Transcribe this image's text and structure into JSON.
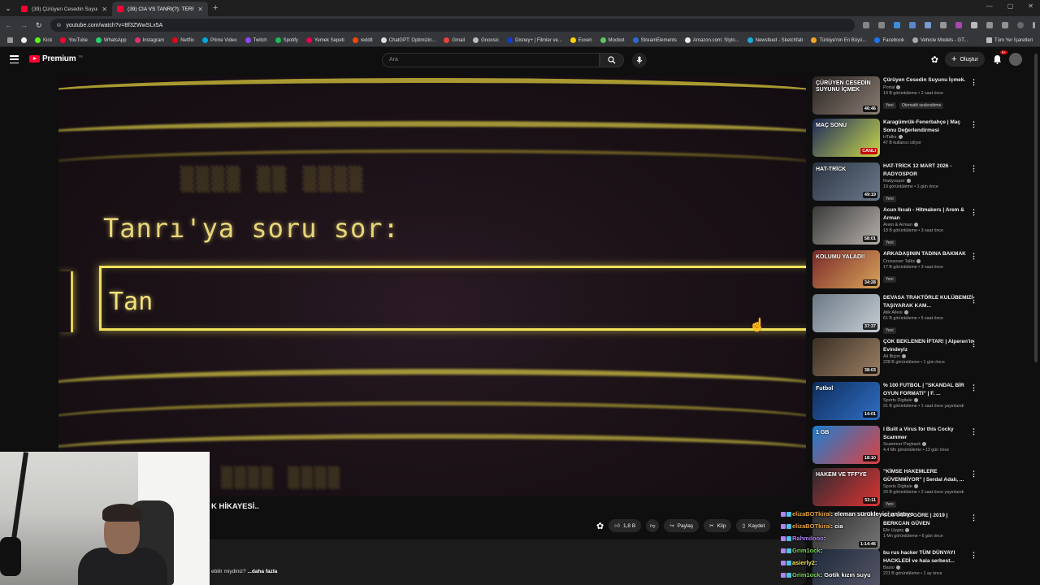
{
  "browser": {
    "tabs": [
      {
        "title": "(39) Çürüyen Cesedin Suyunu İçmek",
        "active": false
      },
      {
        "title": "(39) CIA VS TANRI(?): TERRY DAVIS",
        "active": true
      }
    ],
    "url": "youtube.com/watch?v=Bf3ZWwSLx5A",
    "bookmarks": [
      "Kick",
      "YouTube",
      "WhatsApp",
      "Instagram",
      "Netflix",
      "Prime Video",
      "Twitch",
      "Spotify",
      "Yemek Sepeti",
      "reddit",
      "ChatGPT: Optimizin...",
      "Gmail",
      "Gnoosic",
      "Disney+ | Filmler ve...",
      "Exxen",
      "Moobot",
      "StreamElements",
      "Amazon.com: Stylo...",
      "Newsfeed - Sketchfab",
      "Türkiye'nin En Büyü...",
      "Facebook",
      "Vehicle Models - GT..."
    ],
    "bookmarks_all": "Tüm Yer İşaretleri"
  },
  "youtube": {
    "logo": "Premium",
    "logo_region": "TR",
    "search_placeholder": "Ara",
    "create_label": "Oluştur",
    "notif_count": "9+"
  },
  "video": {
    "prompt": "Tanrı'ya soru sor:",
    "input_text": "Tan",
    "title": "K HİKAYESİ..",
    "likes": "1,8 B",
    "share": "Paylaş",
    "clip": "Klip",
    "save": "Kaydet",
    "description": "ebilir miydiniz?",
    "more": "...daha fazla"
  },
  "chat": [
    {
      "user": "elizaBOTkiral",
      "msg": ": eleman sürükleyici anlatıyo",
      "color": "#e6a23c"
    },
    {
      "user": "elizaBOTkiral",
      "msg": ": cia",
      "color": "#e6a23c"
    },
    {
      "user": "Rahmilooo",
      "msg": ":",
      "color": "#b084f5"
    },
    {
      "user": "Grim1ock",
      "msg": ":",
      "color": "#7ed957"
    },
    {
      "user": "asierly2",
      "msg": ":",
      "color": "#f2e14c"
    },
    {
      "user": "Grim1ock",
      "msg": ": Gotik kızın suyu",
      "color": "#7ed957"
    }
  ],
  "sidebar": [
    {
      "title": "Çürüyen Cesedin Suyunu İçmek.",
      "channel": "Portal",
      "meta": "14 B görüntüleme • 2 saat önce",
      "badge": "Yeni",
      "badge2": "Otomatik seslendirme",
      "duration": "46:46",
      "thumb_text": "ÇÜRÜYEN CESEDİN SUYUNU İÇMEK",
      "c1": "#2a2524",
      "c2": "#8a7c72"
    },
    {
      "title": "Karagümrük-Fenerbahçe | Maç Sonu Değerlendirmesi",
      "channel": "HTalks",
      "meta": "47 B kullanıcı izliyor",
      "badge": "",
      "badge2": "",
      "duration": "CANLI",
      "thumb_text": "MAÇ SONU",
      "c1": "#1d2a5c",
      "c2": "#c9d94a"
    },
    {
      "title": "HAT-TRİCK 12 MART 2026 - RADYOSPOR",
      "channel": "Radyospor",
      "meta": "19 görüntüleme • 1 gün önce",
      "badge": "Yeni",
      "badge2": "",
      "duration": "49:19",
      "thumb_text": "HAT-TRİCK",
      "c1": "#2c3442",
      "c2": "#6b7a8c"
    },
    {
      "title": "Acun Ilıcalı - Hitmakers | Arem & Arman",
      "channel": "Arem & Arman",
      "meta": "18 B görüntüleme • 3 saat önce",
      "badge": "Yeni",
      "badge2": "",
      "duration": "58:01",
      "thumb_text": "",
      "c1": "#3a3a3a",
      "c2": "#b5b0aa"
    },
    {
      "title": "ARKADAŞININ TADINA BAKMAK",
      "channel": "Crossover Talks",
      "meta": "17 B görüntüleme • 3 saat önce",
      "badge": "Yeni",
      "badge2": "",
      "duration": "34:28",
      "thumb_text": "KOLUMU YALADI!",
      "c1": "#7a2a2a",
      "c2": "#d9a35a"
    },
    {
      "title": "DEVASA TRAKTÖRLE KULÜBEMIZİ TAŞIYARAK KAM...",
      "channel": "Atik Ailesi",
      "meta": "61 B görüntüleme • 5 saat önce",
      "badge": "Yeni",
      "badge2": "",
      "duration": "37:37",
      "thumb_text": "",
      "c1": "#6c7a86",
      "c2": "#c6cdd4"
    },
    {
      "title": "ÇOK BEKLENEN İFTAR! | Alperen'in Evindeyiz",
      "channel": "Ali Biçim",
      "meta": "228 B görüntüleme • 1 gün önce",
      "badge": "",
      "badge2": "",
      "duration": "38:03",
      "thumb_text": "",
      "c1": "#3a2f24",
      "c2": "#9c8064"
    },
    {
      "title": "% 100 FUTBOL | \"SKANDAL BİR OYUN FORMATI\" | F. ...",
      "channel": "Sports Digitale",
      "meta": "21 B görüntüleme • 1 saat önce yayınlandı",
      "badge": "",
      "badge2": "",
      "duration": "14:01",
      "thumb_text": "Futbol",
      "c1": "#0f2d5c",
      "c2": "#2f6fc4"
    },
    {
      "title": "I Built a Virus for this Cocky Scammer",
      "channel": "Scammer Payback",
      "meta": "4,4 Mn görüntüleme • 13 gün önce",
      "badge": "",
      "badge2": "",
      "duration": "18:10",
      "thumb_text": "1 GB",
      "c1": "#1a7fd1",
      "c2": "#e04040"
    },
    {
      "title": "\"KİMSE HAKEMLERE GÜVENMİYOR\" | Serdal Adalı, ...",
      "channel": "Sports Digitale",
      "meta": "20 B görüntüleme • 2 saat önce yayınlandı",
      "badge": "Yeni",
      "badge2": "",
      "duration": "53:11",
      "thumb_text": "HAKEM VE TFF'YE",
      "c1": "#2b2b30",
      "c2": "#d33"
    },
    {
      "title": "GÖZ GÖRE GÖRE | 2019 | BERKCAN GÜVEN",
      "channel": "Efe Uygaç",
      "meta": "1 Mn görüntüleme • 6 gün önce",
      "badge": "",
      "badge2": "",
      "duration": "1:14:46",
      "thumb_text": "",
      "c1": "#2a2a2a",
      "c2": "#777"
    },
    {
      "title": "bu rus hacker TÜM DÜNYAYI HACKLEDİ ve hala serbest...",
      "channel": "Basio",
      "meta": "221 B görüntüleme • 1 ay önce",
      "badge": "",
      "badge2": "",
      "duration": "",
      "thumb_text": "",
      "c1": "#1e2a3a",
      "c2": "#556"
    }
  ]
}
